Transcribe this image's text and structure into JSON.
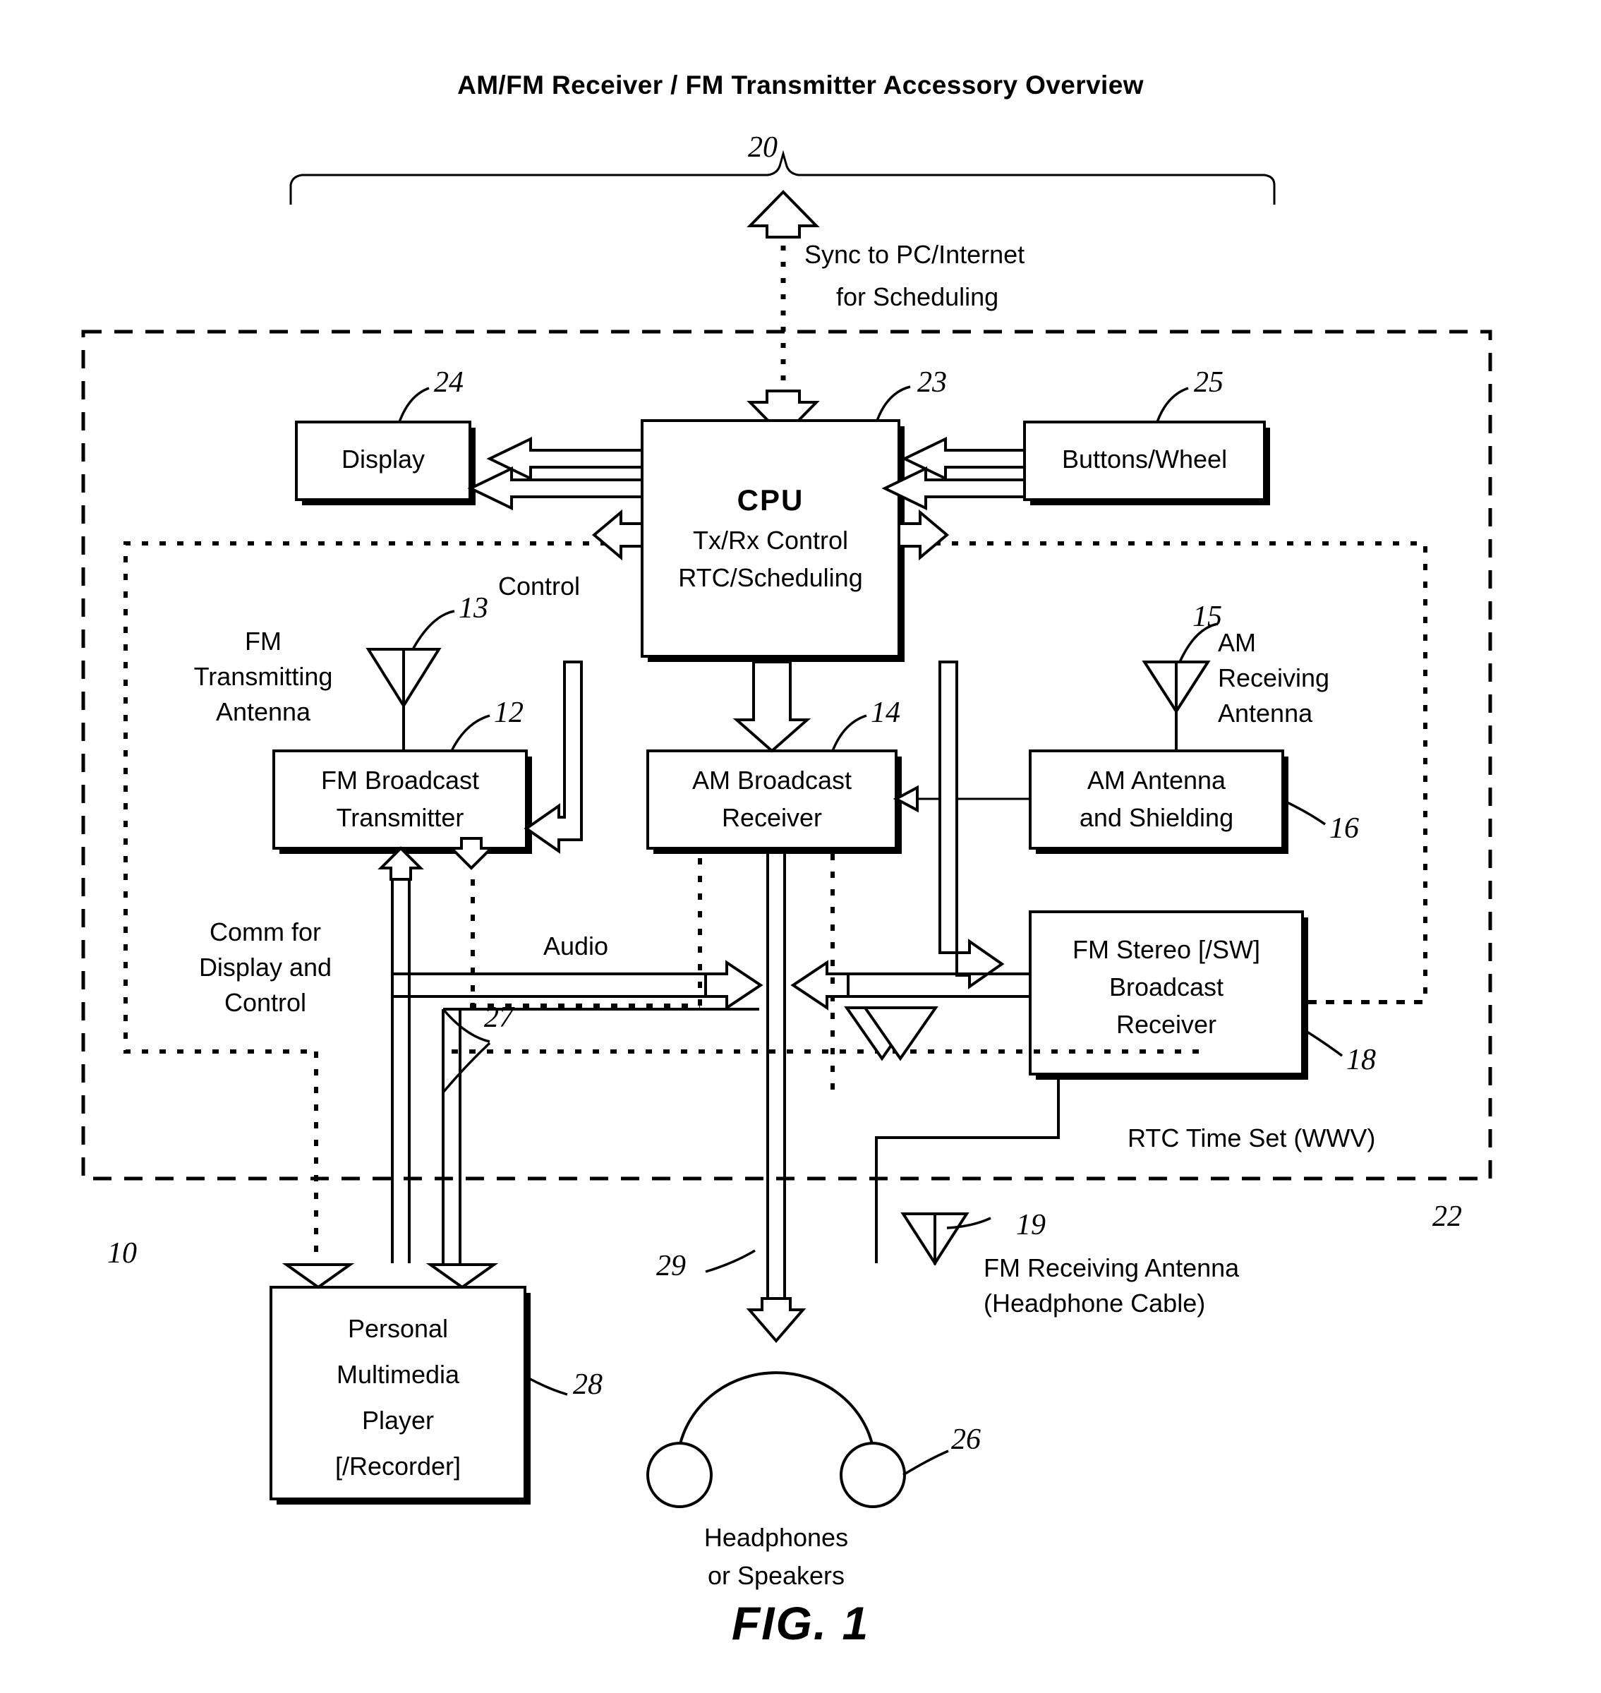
{
  "figure": {
    "title": "AM/FM Receiver / FM Transmitter Accessory Overview",
    "caption": "FIG. 1"
  },
  "blocks": {
    "cpu": {
      "line1": "CPU",
      "line2": "Tx/Rx Control",
      "line3": "RTC/Scheduling",
      "ref": "23"
    },
    "display": {
      "label": "Display",
      "ref": "24"
    },
    "buttons": {
      "label": "Buttons/Wheel",
      "ref": "25"
    },
    "fm_transmitter": {
      "line1": "FM Broadcast",
      "line2": "Transmitter",
      "ref": "12"
    },
    "am_receiver": {
      "line1": "AM Broadcast",
      "line2": "Receiver",
      "ref": "14"
    },
    "am_antenna_shield": {
      "line1": "AM Antenna",
      "line2": "and Shielding",
      "ref": "16"
    },
    "fm_stereo_receiver": {
      "line1": "FM Stereo [/SW]",
      "line2": "Broadcast",
      "line3": "Receiver",
      "ref": "18"
    },
    "player": {
      "line1": "Personal",
      "line2": "Multimedia",
      "line3": "Player",
      "line4": "[/Recorder]",
      "ref": "28"
    }
  },
  "antennas": {
    "fm_tx": {
      "line1": "FM",
      "line2": "Transmitting",
      "line3": "Antenna",
      "ref": "13"
    },
    "am_rx": {
      "line1": "AM",
      "line2": "Receiving",
      "line3": "Antenna",
      "ref": "15"
    },
    "fm_rx": {
      "line1": "FM Receiving Antenna",
      "line2": "(Headphone Cable)",
      "ref": "19"
    }
  },
  "labels": {
    "sync": {
      "line1": "Sync to PC/Internet",
      "line2": "for Scheduling"
    },
    "control": "Control",
    "audio": "Audio",
    "comm": {
      "line1": "Comm for",
      "line2": "Display and",
      "line3": "Control"
    },
    "rtc_time_set": "RTC Time Set (WWV)",
    "headphones": {
      "line1": "Headphones",
      "line2": "or Speakers"
    }
  },
  "refs": {
    "accessory_bracket": "20",
    "accessory_boundary": "22",
    "system": "10",
    "audio_bus_27": "27",
    "headphone_link_29": "29",
    "headphones_26": "26"
  },
  "colors": {
    "ink": "#000000",
    "paper": "#ffffff"
  }
}
